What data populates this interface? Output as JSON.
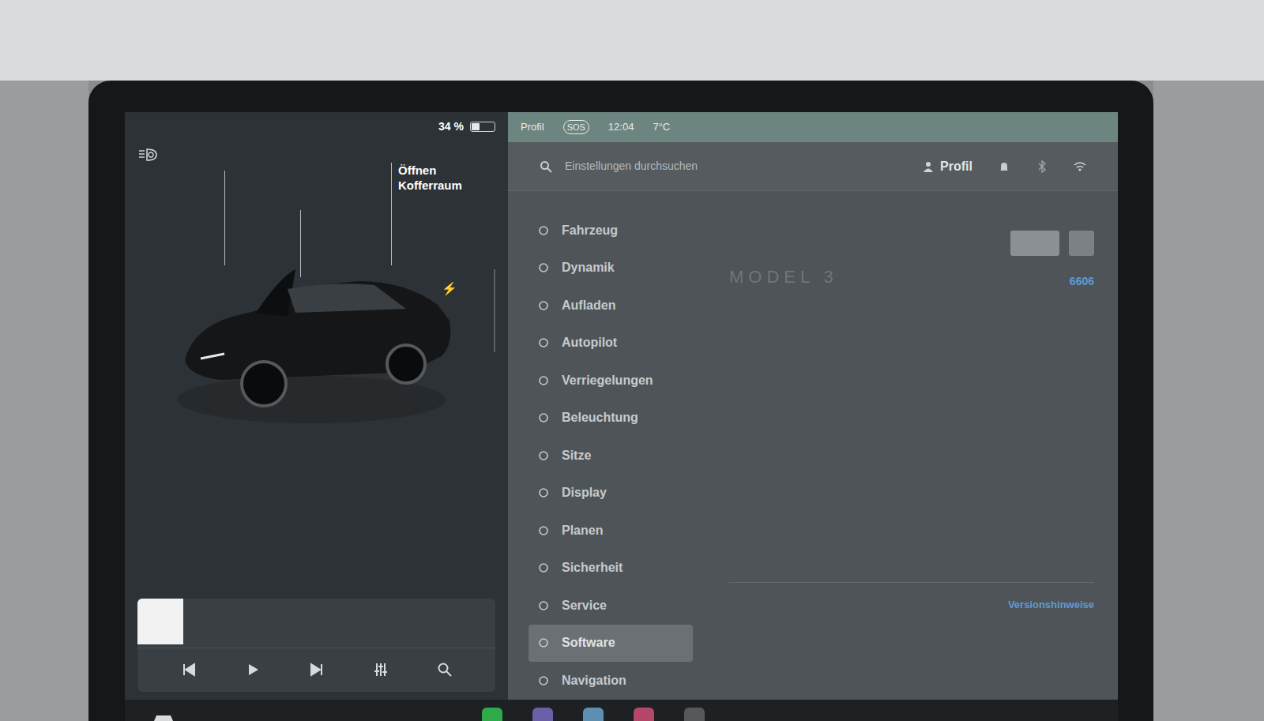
{
  "status": {
    "battery": "34 %",
    "battery_level": 0.34
  },
  "car": {
    "trunk_label": [
      "Öffnen",
      "Kofferraum"
    ],
    "charge_icon": "⚡"
  },
  "map_bar": {
    "profile": "Profil",
    "sos": "SOS",
    "time": "12:04",
    "temp": "7°C"
  },
  "search": {
    "placeholder": "Einstellungen durchsuchen"
  },
  "header": {
    "profile": "Profil"
  },
  "menu": [
    {
      "label": "Fahrzeug",
      "selected": false
    },
    {
      "label": "Dynamik",
      "selected": false
    },
    {
      "label": "Aufladen",
      "selected": false
    },
    {
      "label": "Autopilot",
      "selected": false
    },
    {
      "label": "Verriegelungen",
      "selected": false
    },
    {
      "label": "Beleuchtung",
      "selected": false
    },
    {
      "label": "Sitze",
      "selected": false
    },
    {
      "label": "Display",
      "selected": false
    },
    {
      "label": "Planen",
      "selected": false
    },
    {
      "label": "Sicherheit",
      "selected": false
    },
    {
      "label": "Service",
      "selected": false
    },
    {
      "label": "Software",
      "selected": true
    },
    {
      "label": "Navigation",
      "selected": false
    }
  ],
  "content": {
    "model": "MODEL 3",
    "number": "6606",
    "release_notes": "Versionshinweise"
  }
}
